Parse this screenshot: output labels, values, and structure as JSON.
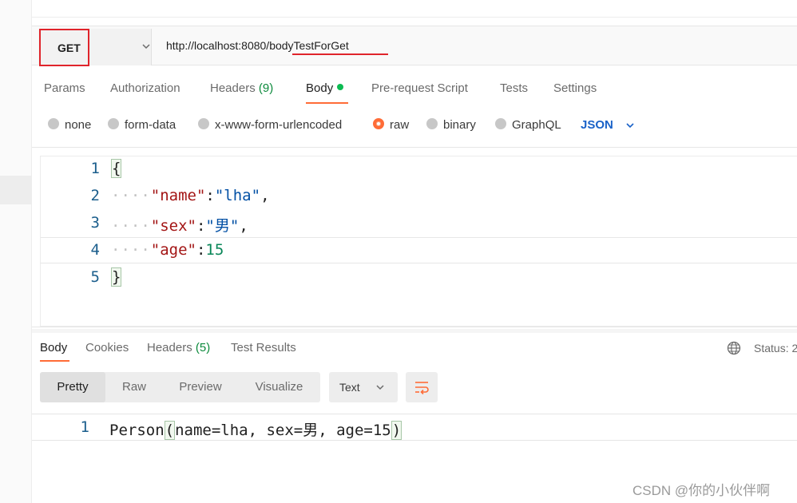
{
  "request": {
    "method": "GET",
    "url": "http://localhost:8080/bodyTestForGet"
  },
  "request_tabs": [
    {
      "label": "Params"
    },
    {
      "label": "Authorization"
    },
    {
      "label": "Headers",
      "count": "(9)"
    },
    {
      "label": "Body"
    },
    {
      "label": "Pre-request Script"
    },
    {
      "label": "Tests"
    },
    {
      "label": "Settings"
    }
  ],
  "body_types": [
    {
      "label": "none"
    },
    {
      "label": "form-data"
    },
    {
      "label": "x-www-form-urlencoded"
    },
    {
      "label": "raw"
    },
    {
      "label": "binary"
    },
    {
      "label": "GraphQL"
    }
  ],
  "raw_format": "JSON",
  "request_body": {
    "line_numbers": [
      "1",
      "2",
      "3",
      "4",
      "5"
    ],
    "open_brace": "{",
    "close_brace": "}",
    "indent": "····",
    "name_key": "\"name\"",
    "name_value": "\"lha\"",
    "sex_key": "\"sex\"",
    "sex_value": "\"男\"",
    "age_key": "\"age\"",
    "age_value": "15",
    "colon": ":",
    "comma": ","
  },
  "response_tabs": [
    {
      "label": "Body"
    },
    {
      "label": "Cookies"
    },
    {
      "label": "Headers",
      "count": "(5)"
    },
    {
      "label": "Test Results"
    }
  ],
  "status_label": "Status: 2",
  "view_modes": [
    "Pretty",
    "Raw",
    "Preview",
    "Visualize"
  ],
  "response_format": "Text",
  "response_body": {
    "line_number": "1",
    "prefix": "Person",
    "open_paren": "(",
    "content": "name=lha, sex=男, age=15",
    "close_paren": ")"
  },
  "watermark": "CSDN @你的小伙伴啊",
  "colors": {
    "accent": "#ff6c37",
    "highlight_box": "#e0242b",
    "json_blue": "#1a62c8",
    "success_green": "#0cbb52"
  }
}
